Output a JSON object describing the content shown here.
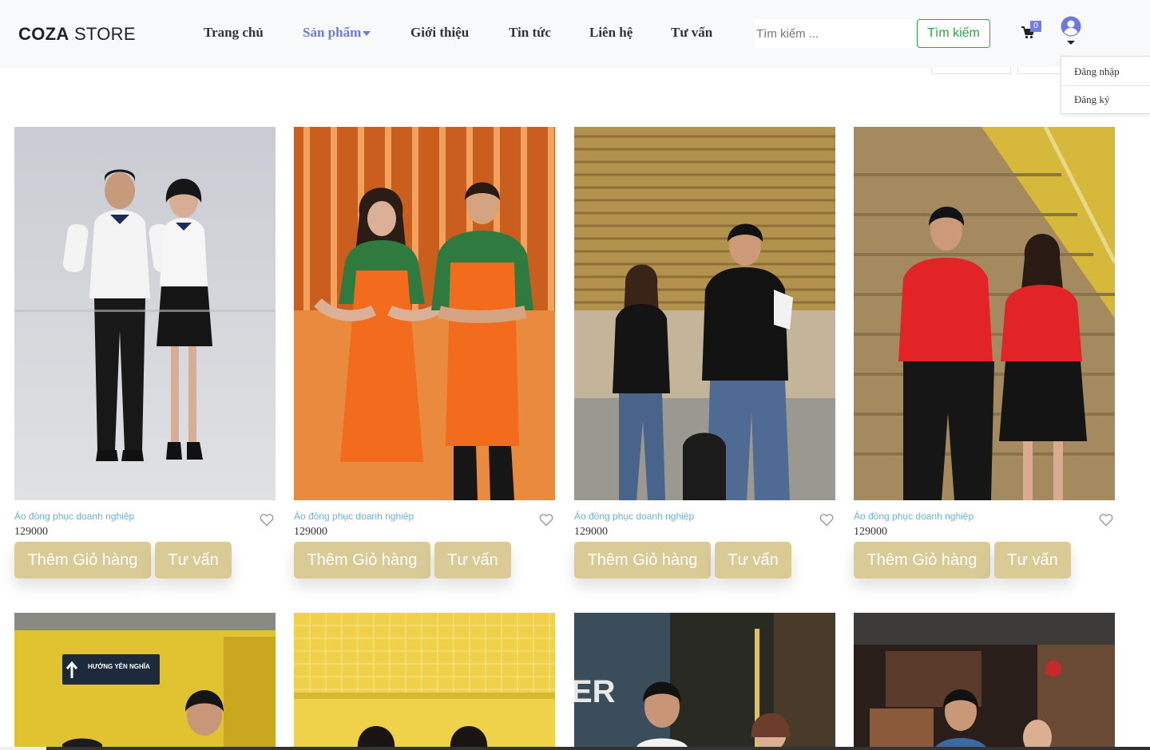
{
  "header": {
    "logo_bold": "COZA",
    "logo_rest": " STORE",
    "nav": [
      {
        "label": "Trang chủ"
      },
      {
        "label": "Sản phẩm"
      },
      {
        "label": "Giới thiệu"
      },
      {
        "label": "Tin tức"
      },
      {
        "label": "Liên hệ"
      },
      {
        "label": "Tư vấn"
      }
    ],
    "search": {
      "placeholder": "Tìm kiếm ...",
      "button_label": "Tìm kiếm"
    },
    "cart_count": "0",
    "user_menu": {
      "login": "Đăng nhập",
      "register": "Đăng ký"
    }
  },
  "products": [
    {
      "category": "Áo đồng phục doanh nghiệp",
      "price": "129000",
      "add_label": "Thêm Giỏ hàng",
      "advise_label": "Tư vấn"
    },
    {
      "category": "Áo đồng phục doanh nghiệp",
      "price": "129000",
      "add_label": "Thêm Giỏ hàng",
      "advise_label": "Tư vấn"
    },
    {
      "category": "Áo đồng phục doanh nghiệp",
      "price": "129000",
      "add_label": "Thêm Giỏ hàng",
      "advise_label": "Tư vấn"
    },
    {
      "category": "Áo đồng phục doanh nghiệp",
      "price": "129000",
      "add_label": "Thêm Giỏ hàng",
      "advise_label": "Tư vấn"
    }
  ],
  "second_row": {
    "sign_text": "HƯỚNG YÊN NGHĨA"
  },
  "colors": {
    "accent": "#6c7ae0",
    "gold_button": "#dacb96",
    "search_green": "#28a745",
    "category_blue": "#66b2e8"
  }
}
